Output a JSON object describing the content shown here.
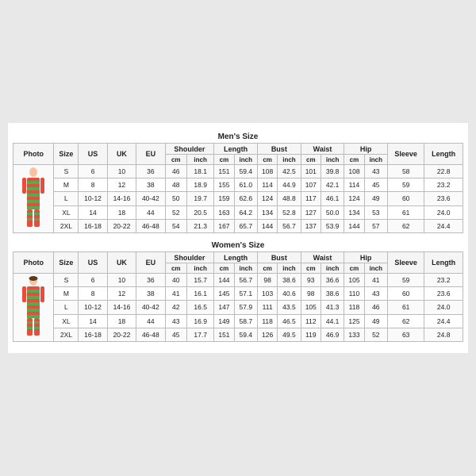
{
  "mens": {
    "title": "Men's Size",
    "headers": [
      "Photo",
      "Size",
      "US",
      "UK",
      "EU",
      "cm",
      "inch",
      "cm",
      "inch",
      "cm",
      "inch",
      "cm",
      "inch",
      "cm",
      "inch",
      "cm",
      "inch"
    ],
    "group_headers": [
      "Shoulder",
      "Length",
      "Bust",
      "Waist",
      "Hip",
      "Sleeve",
      "Length"
    ],
    "rows": [
      {
        "size": "S",
        "us": "6",
        "uk": "10",
        "eu": "36",
        "shoulder_cm": "46",
        "shoulder_in": "18.1",
        "length_cm": "151",
        "length_in": "59.4",
        "bust_cm": "108",
        "bust_in": "42.5",
        "waist_cm": "101",
        "waist_in": "39.8",
        "hip_cm": "108",
        "hip_in": "43",
        "sleeve_cm": "58",
        "sleeve_in": "22.8"
      },
      {
        "size": "M",
        "us": "8",
        "uk": "12",
        "eu": "38",
        "shoulder_cm": "48",
        "shoulder_in": "18.9",
        "length_cm": "155",
        "length_in": "61.0",
        "bust_cm": "114",
        "bust_in": "44.9",
        "waist_cm": "107",
        "waist_in": "42.1",
        "hip_cm": "114",
        "hip_in": "45",
        "sleeve_cm": "59",
        "sleeve_in": "23.2"
      },
      {
        "size": "L",
        "us": "10-12",
        "uk": "14-16",
        "eu": "40-42",
        "shoulder_cm": "50",
        "shoulder_in": "19.7",
        "length_cm": "159",
        "length_in": "62.6",
        "bust_cm": "124",
        "bust_in": "48.8",
        "waist_cm": "117",
        "waist_in": "46.1",
        "hip_cm": "124",
        "hip_in": "49",
        "sleeve_cm": "60",
        "sleeve_in": "23.6"
      },
      {
        "size": "XL",
        "us": "14",
        "uk": "18",
        "eu": "44",
        "shoulder_cm": "52",
        "shoulder_in": "20.5",
        "length_cm": "163",
        "length_in": "64.2",
        "bust_cm": "134",
        "bust_in": "52.8",
        "waist_cm": "127",
        "waist_in": "50.0",
        "hip_cm": "134",
        "hip_in": "53",
        "sleeve_cm": "61",
        "sleeve_in": "24.0"
      },
      {
        "size": "2XL",
        "us": "16-18",
        "uk": "20-22",
        "eu": "46-48",
        "shoulder_cm": "54",
        "shoulder_in": "21.3",
        "length_cm": "167",
        "length_in": "65.7",
        "bust_cm": "144",
        "bust_in": "56.7",
        "waist_cm": "137",
        "waist_in": "53.9",
        "hip_cm": "144",
        "hip_in": "57",
        "sleeve_cm": "62",
        "sleeve_in": "24.4"
      }
    ]
  },
  "womens": {
    "title": "Women's Size",
    "headers": [
      "Photo",
      "Size",
      "US",
      "UK",
      "EU",
      "cm",
      "inch",
      "cm",
      "inch",
      "cm",
      "inch",
      "cm",
      "inch",
      "cm",
      "inch",
      "cm",
      "inch"
    ],
    "group_headers": [
      "Shoulder",
      "Length",
      "Bust",
      "Waist",
      "Hip",
      "Sleeve",
      "Length"
    ],
    "rows": [
      {
        "size": "S",
        "us": "6",
        "uk": "10",
        "eu": "36",
        "shoulder_cm": "40",
        "shoulder_in": "15.7",
        "length_cm": "144",
        "length_in": "56.7",
        "bust_cm": "98",
        "bust_in": "38.6",
        "waist_cm": "93",
        "waist_in": "36.6",
        "hip_cm": "105",
        "hip_in": "41",
        "sleeve_cm": "59",
        "sleeve_in": "23.2"
      },
      {
        "size": "M",
        "us": "8",
        "uk": "12",
        "eu": "38",
        "shoulder_cm": "41",
        "shoulder_in": "16.1",
        "length_cm": "145",
        "length_in": "57.1",
        "bust_cm": "103",
        "bust_in": "40.6",
        "waist_cm": "98",
        "waist_in": "38.6",
        "hip_cm": "110",
        "hip_in": "43",
        "sleeve_cm": "60",
        "sleeve_in": "23.6"
      },
      {
        "size": "L",
        "us": "10-12",
        "uk": "14-16",
        "eu": "40-42",
        "shoulder_cm": "42",
        "shoulder_in": "16.5",
        "length_cm": "147",
        "length_in": "57.9",
        "bust_cm": "111",
        "bust_in": "43.5",
        "waist_cm": "105",
        "waist_in": "41.3",
        "hip_cm": "118",
        "hip_in": "46",
        "sleeve_cm": "61",
        "sleeve_in": "24.0"
      },
      {
        "size": "XL",
        "us": "14",
        "uk": "18",
        "eu": "44",
        "shoulder_cm": "43",
        "shoulder_in": "16.9",
        "length_cm": "149",
        "length_in": "58.7",
        "bust_cm": "118",
        "bust_in": "46.5",
        "waist_cm": "112",
        "waist_in": "44.1",
        "hip_cm": "125",
        "hip_in": "49",
        "sleeve_cm": "62",
        "sleeve_in": "24.4"
      },
      {
        "size": "2XL",
        "us": "16-18",
        "uk": "20-22",
        "eu": "46-48",
        "shoulder_cm": "45",
        "shoulder_in": "17.7",
        "length_cm": "151",
        "length_in": "59.4",
        "bust_cm": "126",
        "bust_in": "49.5",
        "waist_cm": "119",
        "waist_in": "46.9",
        "hip_cm": "133",
        "hip_in": "52",
        "sleeve_cm": "63",
        "sleeve_in": "24.8"
      }
    ]
  },
  "labels": {
    "photo": "Photo",
    "size": "Size",
    "us": "US",
    "uk": "UK",
    "eu": "EU",
    "shoulder": "Shoulder",
    "length": "Length",
    "bust": "Bust",
    "waist": "Waist",
    "hip": "Hip",
    "sleeve": "Sleeve",
    "cm": "cm",
    "inch": "inch"
  }
}
